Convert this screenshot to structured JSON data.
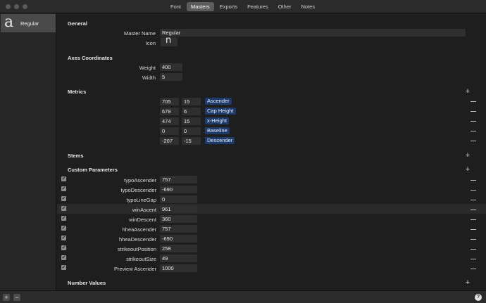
{
  "tabs": [
    "Font",
    "Masters",
    "Exports",
    "Features",
    "Other",
    "Notes"
  ],
  "active_tab": "Masters",
  "sidebar": {
    "master_glyph": "a",
    "master_name": "Regular"
  },
  "general": {
    "title": "General",
    "master_name_label": "Master Name",
    "master_name_value": "Regular",
    "icon_label": "Icon",
    "icon_glyph": "n"
  },
  "axes": {
    "title": "Axes Coordinates",
    "weight_label": "Weight",
    "weight_value": "400",
    "width_label": "Width",
    "width_value": "5"
  },
  "metrics": {
    "title": "Metrics",
    "rows": [
      {
        "pos": "705",
        "over": "15",
        "name": "Ascender"
      },
      {
        "pos": "678",
        "over": "6",
        "name": "Cap Height"
      },
      {
        "pos": "474",
        "over": "15",
        "name": "x-Height"
      },
      {
        "pos": "0",
        "over": "0",
        "name": "Baseline"
      },
      {
        "pos": "-207",
        "over": "-15",
        "name": "Descender"
      }
    ]
  },
  "stems": {
    "title": "Stems"
  },
  "custom": {
    "title": "Custom Parameters",
    "rows": [
      {
        "name": "typoAscender",
        "value": "757"
      },
      {
        "name": "typoDescender",
        "value": "-690"
      },
      {
        "name": "typoLineGap",
        "value": "0"
      },
      {
        "name": "winAscent",
        "value": "961"
      },
      {
        "name": "winDescent",
        "value": "360"
      },
      {
        "name": "hheaAscender",
        "value": "757"
      },
      {
        "name": "hheaDescender",
        "value": "-690"
      },
      {
        "name": "strikeoutPosition",
        "value": "258"
      },
      {
        "name": "strikeoutSize",
        "value": "49"
      },
      {
        "name": "Preview Ascender",
        "value": "1000"
      }
    ]
  },
  "number_values": {
    "title": "Number Values"
  },
  "bottom": {
    "add": "+",
    "remove": "−",
    "help": "?"
  }
}
